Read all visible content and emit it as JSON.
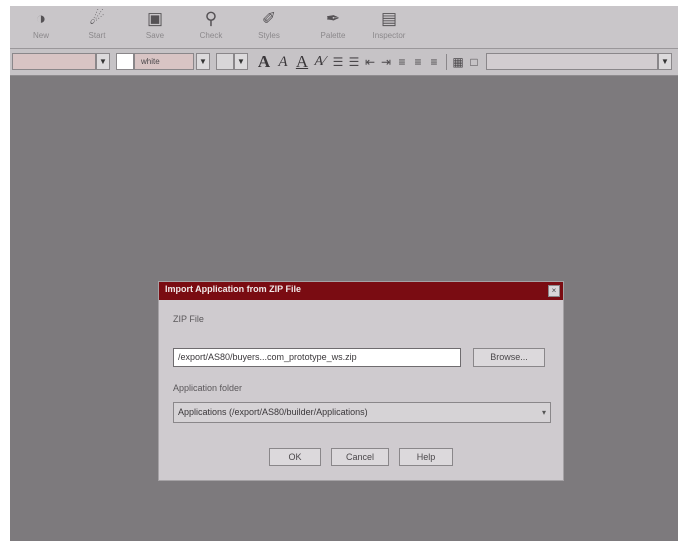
{
  "toolbar": {
    "buttons": [
      {
        "label": "New",
        "icon": "new-icon"
      },
      {
        "label": "Start",
        "icon": "start-icon"
      },
      {
        "label": "Save",
        "icon": "save-icon"
      },
      {
        "label": "Check",
        "icon": "check-icon"
      },
      {
        "label": "Styles",
        "icon": "styles-icon"
      },
      {
        "label": "Palette",
        "icon": "palette-icon"
      },
      {
        "label": "Inspector",
        "icon": "inspector-icon"
      }
    ]
  },
  "format_bar": {
    "font_color_value": "white"
  },
  "dialog": {
    "title": "Import Application from ZIP File",
    "zip_label": "ZIP File",
    "zip_value": "/export/AS80/buyers...com_prototype_ws.zip",
    "browse_label": "Browse...",
    "folder_label": "Application folder",
    "folder_value": "Applications (/export/AS80/builder/Applications)",
    "ok_label": "OK",
    "cancel_label": "Cancel",
    "help_label": "Help"
  },
  "colors": {
    "titlebar": "#7a0c12",
    "workspace": "#7d7a7d",
    "dialog": "#cfcbcf"
  }
}
